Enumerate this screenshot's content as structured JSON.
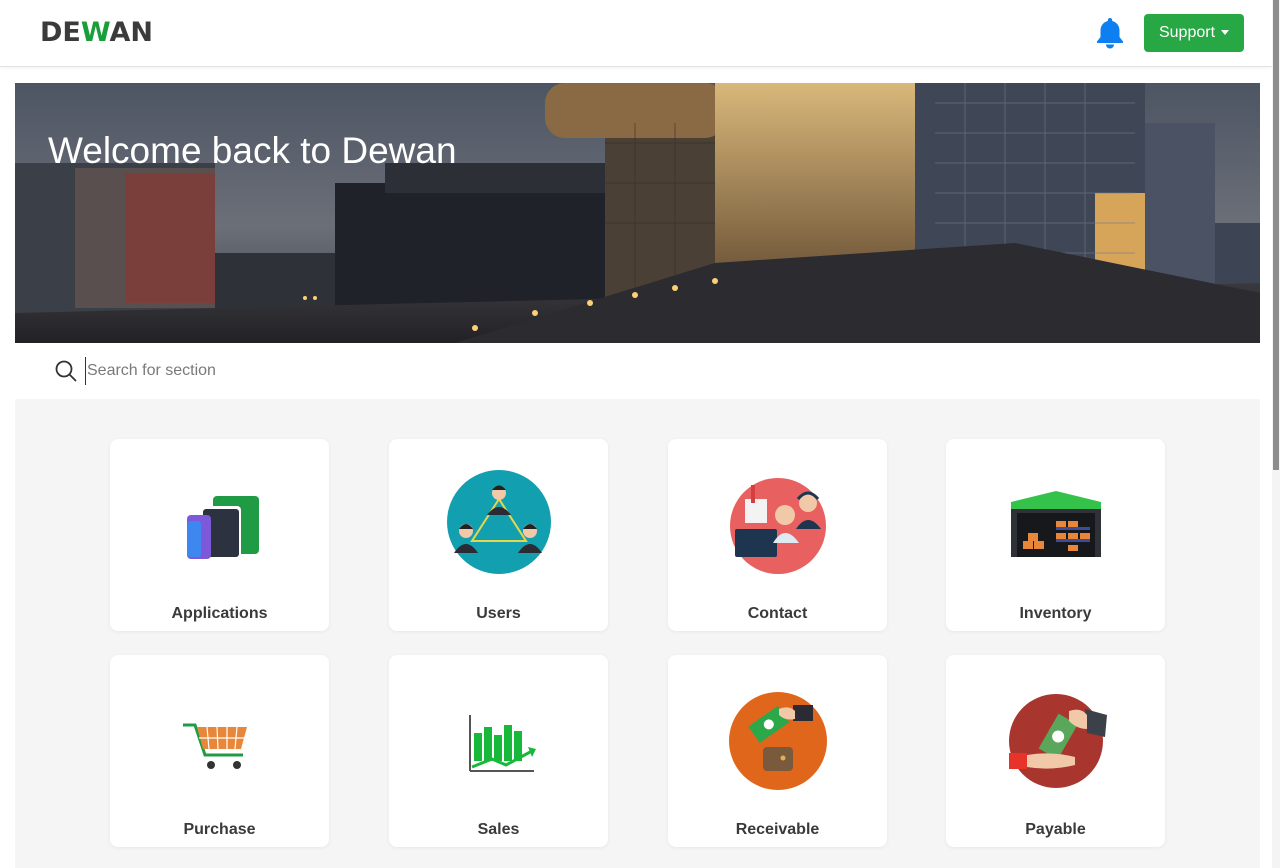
{
  "brand": {
    "logo_left": "DE",
    "logo_mid": "W",
    "logo_right": "AN",
    "accent": "#28a745"
  },
  "header": {
    "bell_icon": "bell-icon",
    "support_label": "Support"
  },
  "hero": {
    "title": "Welcome back to Dewan"
  },
  "search": {
    "placeholder": "Search for section",
    "icon": "search-icon"
  },
  "sections": [
    {
      "label": "Applications",
      "icon": "applications-icon"
    },
    {
      "label": "Users",
      "icon": "users-icon"
    },
    {
      "label": "Contact",
      "icon": "contact-icon"
    },
    {
      "label": "Inventory",
      "icon": "inventory-icon"
    },
    {
      "label": "Purchase",
      "icon": "purchase-icon"
    },
    {
      "label": "Sales",
      "icon": "sales-icon"
    },
    {
      "label": "Receivable",
      "icon": "receivable-icon"
    },
    {
      "label": "Payable",
      "icon": "payable-icon"
    }
  ]
}
